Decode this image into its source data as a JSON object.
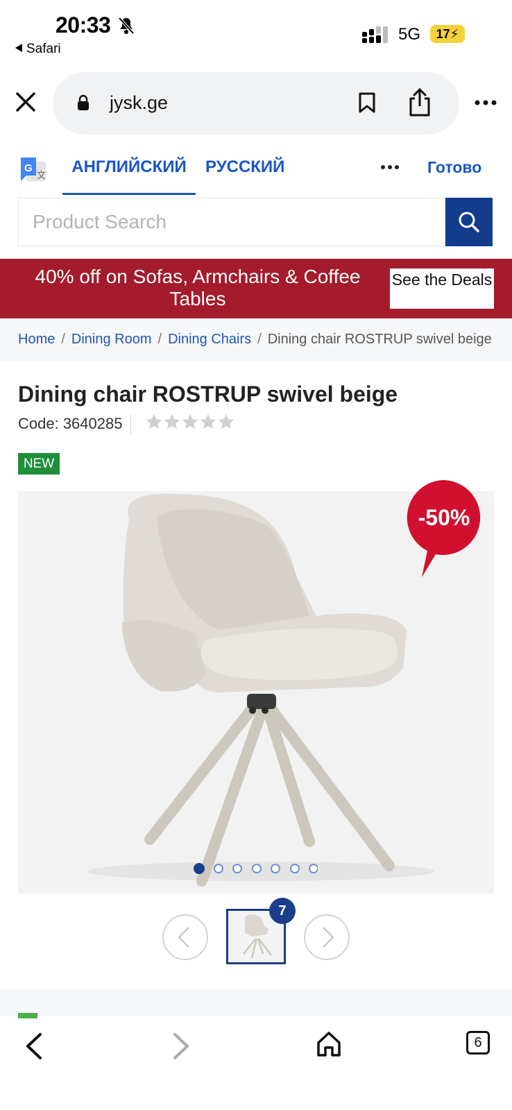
{
  "status_bar": {
    "time": "20:33",
    "back_app": "Safari",
    "network": "5G",
    "battery": "17"
  },
  "browser": {
    "url": "jysk.ge",
    "tab_count": "6"
  },
  "translate_bar": {
    "lang_english": "АНГЛИЙСКИЙ",
    "lang_russian": "РУССКИЙ",
    "done": "Готово"
  },
  "search": {
    "placeholder": "Product Search"
  },
  "promo": {
    "text": "40% off on Sofas, Armchairs & Coffee Tables",
    "button": "See the Deals"
  },
  "breadcrumb": [
    "Home",
    "Dining Room",
    "Dining Chairs",
    "Dining chair ROSTRUP swivel beige"
  ],
  "product": {
    "title": "Dining chair ROSTRUP swivel beige",
    "code": "Code: 3640285",
    "rating_stars": 0,
    "rating_max": 5,
    "badge": "NEW",
    "discount": "-50%",
    "image_count": "7",
    "carousel_dots": 7,
    "carousel_active": 1
  },
  "colors": {
    "brand_blue": "#143c8c",
    "link_blue": "#1f57b4",
    "promo_red": "#a31b2c",
    "discount_red": "#d0102e",
    "new_green": "#1f8f3a"
  }
}
